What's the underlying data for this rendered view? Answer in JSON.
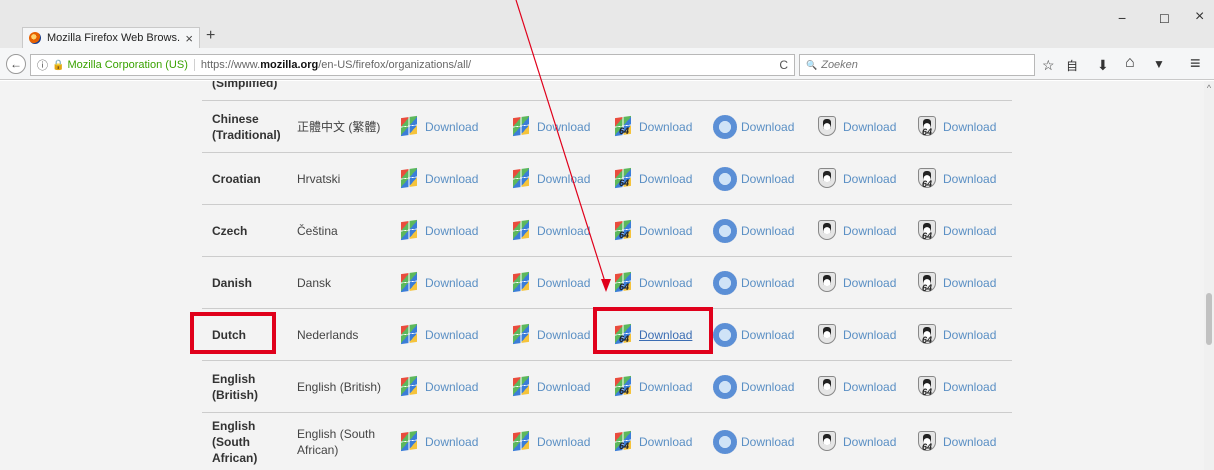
{
  "browser": {
    "tab_title": "Mozilla Firefox Web Brows...",
    "tab_close": "×",
    "new_tab": "+",
    "window_controls": {
      "minimize": "−",
      "maximize": "☐",
      "close": "×"
    },
    "back": "←",
    "info": "ⓘ",
    "lock": "🔒",
    "org": "Mozilla Corporation (US)",
    "url_prefix": "https://www.",
    "url_host": "mozilla.org",
    "url_path": "/en-US/firefox/organizations/all/",
    "reload": "C",
    "search_icon": "🔍",
    "search_placeholder": "Zoeken",
    "toolbar_icons": {
      "bookmark": "☆",
      "library": "自",
      "downloads": "⬇",
      "home": "⌂",
      "pocket": "▼",
      "menu": "≡"
    },
    "scroll_up": "^"
  },
  "downloads": {
    "label": "Download",
    "columns": [
      "windows-32",
      "windows-32-full",
      "windows-64",
      "mac",
      "linux-32",
      "linux-64"
    ],
    "rows": [
      {
        "lang": "Chinese (Traditional)",
        "native": "正體中文 (繁體)"
      },
      {
        "lang": "Croatian",
        "native": "Hrvatski"
      },
      {
        "lang": "Czech",
        "native": "Čeština"
      },
      {
        "lang": "Danish",
        "native": "Dansk"
      },
      {
        "lang": "Dutch",
        "native": "Nederlands"
      },
      {
        "lang": "English (British)",
        "native": "English (British)"
      },
      {
        "lang": "English (South African)",
        "native": "English (South African)"
      }
    ],
    "partial_top_row": "(Simplified)",
    "highlight": {
      "row": "Dutch",
      "column": "windows-64"
    },
    "badge_64": "64"
  },
  "colors": {
    "link": "#5a8fc4",
    "annotation": "#e0001b",
    "org_green": "#39a200"
  }
}
